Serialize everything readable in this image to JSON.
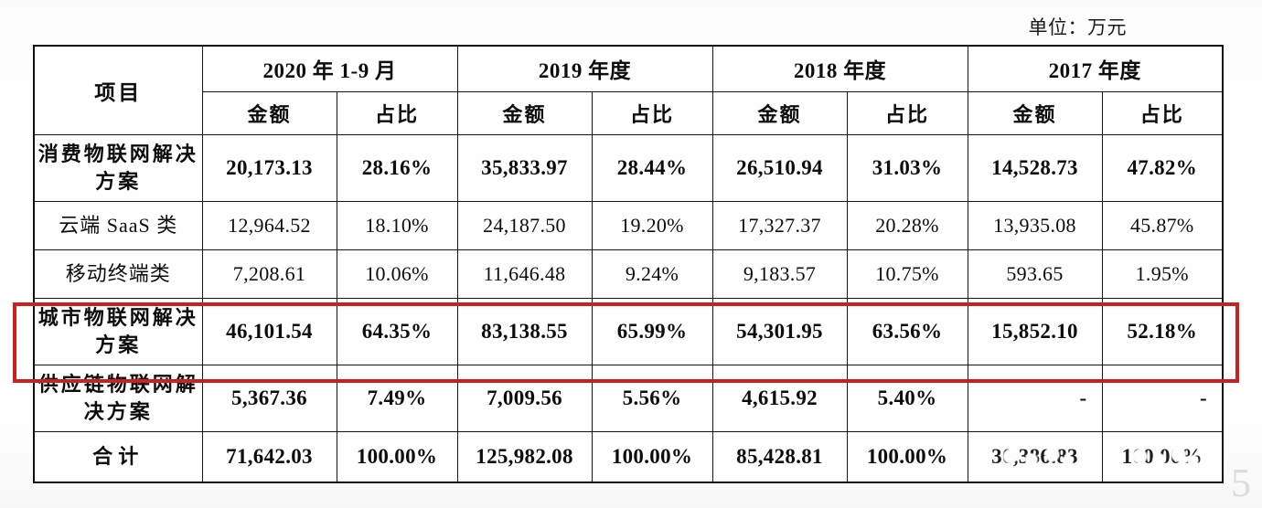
{
  "unit_note": "单位：万元",
  "highlight": {
    "color": "#cc1f1f",
    "target_row_label": "城市物联网解决方案"
  },
  "table": {
    "corner_header": "项目",
    "period_headers": [
      "2020 年 1-9 月",
      "2019 年度",
      "2018 年度",
      "2017 年度"
    ],
    "sub_headers": [
      "金额",
      "占比"
    ],
    "rows": [
      {
        "label": "消费物联网解决方案",
        "style": "bold",
        "cells": [
          "20,173.13",
          "28.16%",
          "35,833.97",
          "28.44%",
          "26,510.94",
          "31.03%",
          "14,528.73",
          "47.82%"
        ]
      },
      {
        "label": "云端 SaaS 类",
        "style": "light",
        "cells": [
          "12,964.52",
          "18.10%",
          "24,187.50",
          "19.20%",
          "17,327.37",
          "20.28%",
          "13,935.08",
          "45.87%"
        ]
      },
      {
        "label": "移动终端类",
        "style": "light",
        "cells": [
          "7,208.61",
          "10.06%",
          "11,646.48",
          "9.24%",
          "9,183.57",
          "10.75%",
          "593.65",
          "1.95%"
        ]
      },
      {
        "label": "城市物联网解决方案",
        "style": "bold",
        "cells": [
          "46,101.54",
          "64.35%",
          "83,138.55",
          "65.99%",
          "54,301.95",
          "63.56%",
          "15,852.10",
          "52.18%"
        ]
      },
      {
        "label": "供应链物联网解决方案",
        "style": "bold",
        "cells": [
          "5,367.36",
          "7.49%",
          "7,009.56",
          "5.56%",
          "4,615.92",
          "5.40%",
          "-",
          "-"
        ]
      },
      {
        "label": "合计",
        "style": "total",
        "cells": [
          "71,642.03",
          "100.00%",
          "125,982.08",
          "100.00%",
          "85,428.81",
          "100.00%",
          "30,386.83",
          "100.00%"
        ]
      }
    ]
  },
  "watermark_text": "5"
}
